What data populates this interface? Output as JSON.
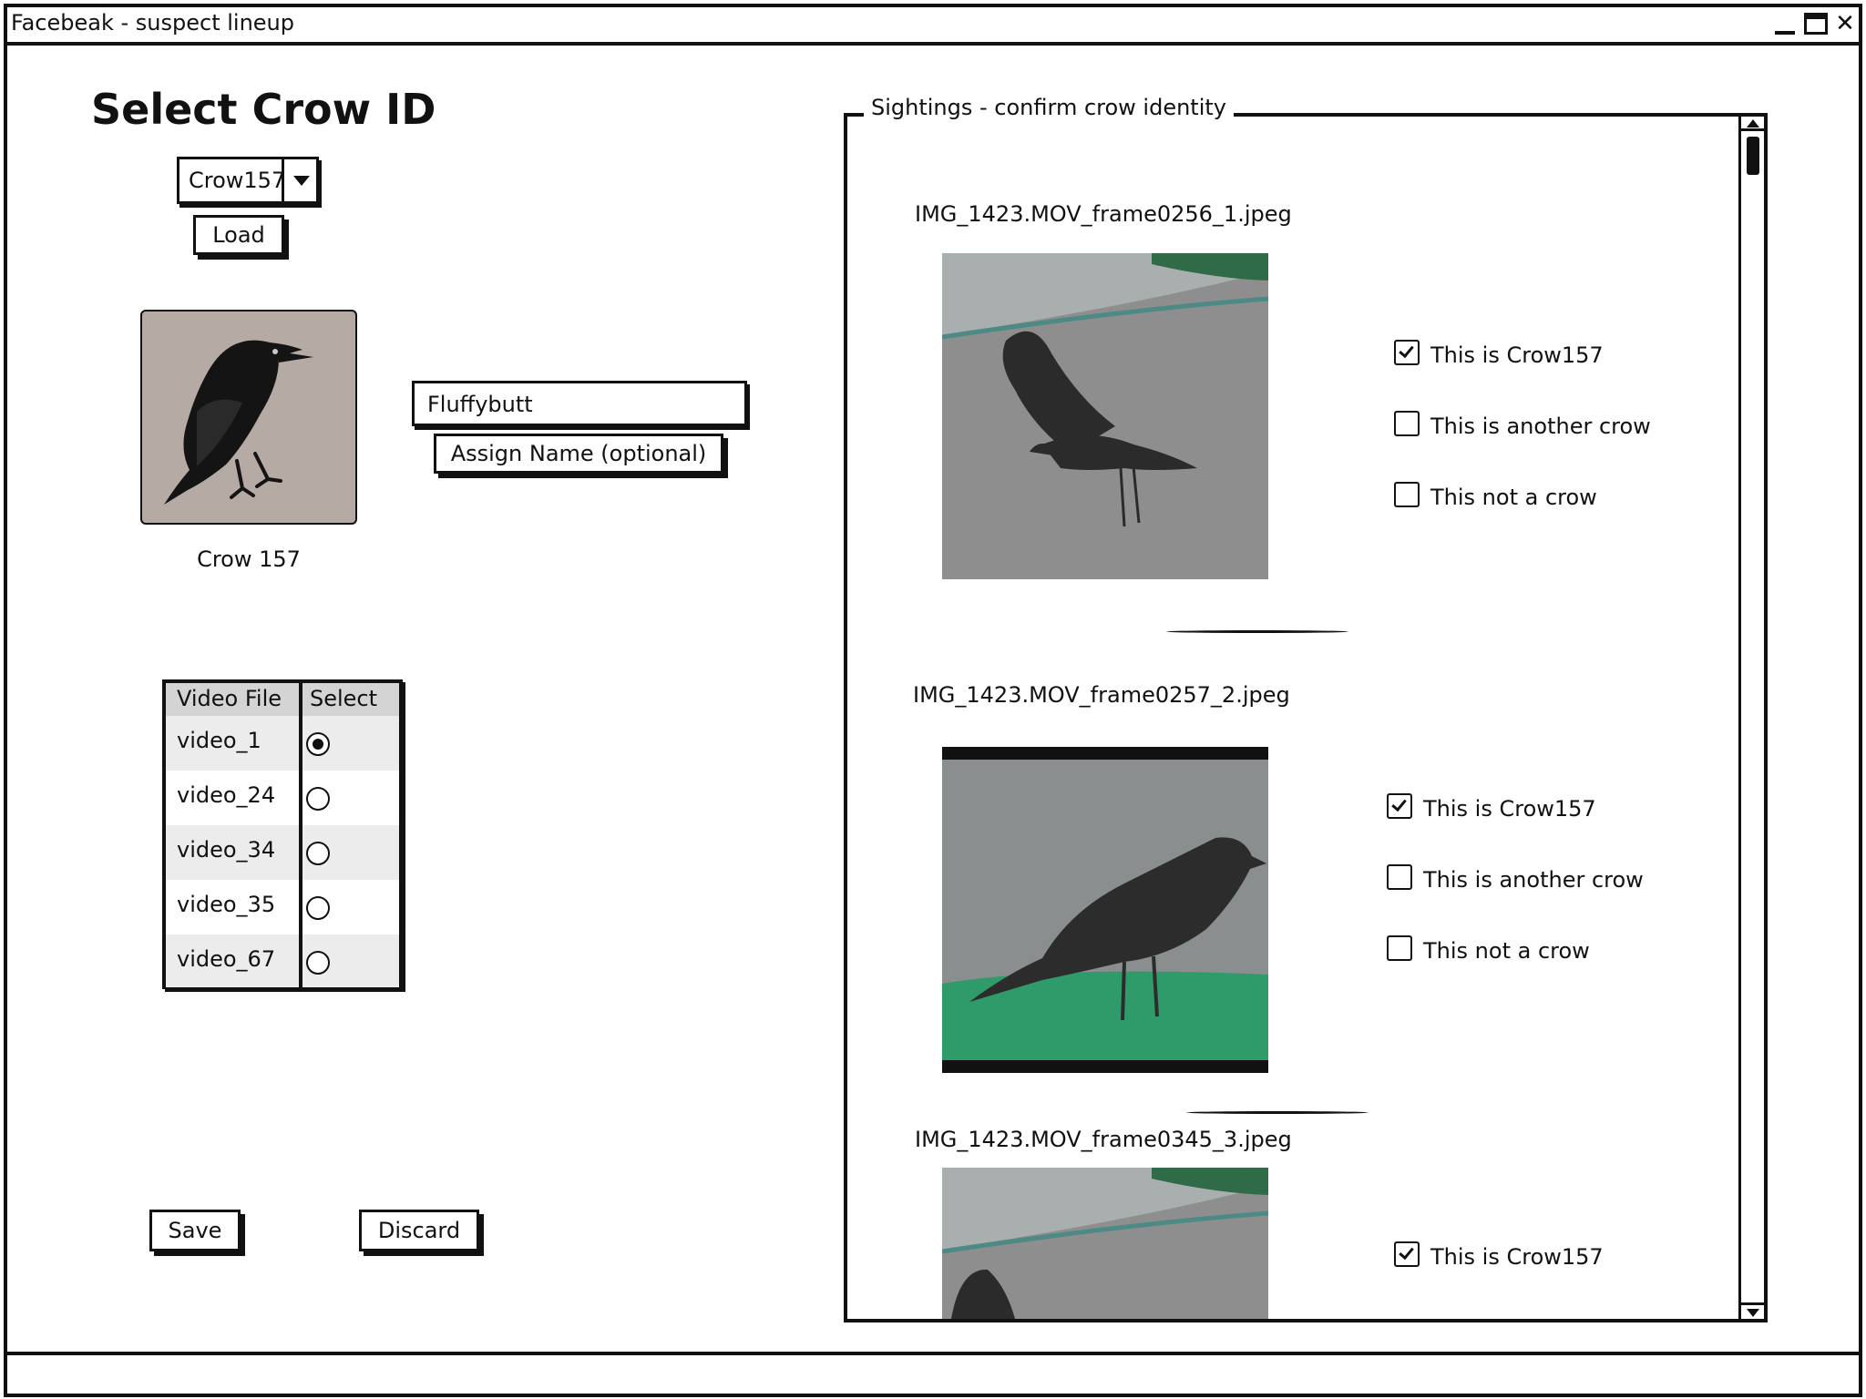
{
  "window": {
    "title": "Facebeak - suspect lineup",
    "controls": [
      "minimize-icon",
      "maximize-icon",
      "close-icon"
    ]
  },
  "left_panel": {
    "title": "Select Crow ID",
    "crow_select": {
      "value": "Crow157",
      "icon": "chevron-down-icon"
    },
    "load_label": "Load",
    "portrait_caption": "Crow 157",
    "name_input": {
      "value": "Fluffybutt"
    },
    "assign_label": "Assign Name (optional)"
  },
  "video_table": {
    "headers": [
      "Video File",
      "Select"
    ],
    "rows": [
      {
        "file": "video_1",
        "selected": true
      },
      {
        "file": "video_24",
        "selected": false
      },
      {
        "file": "video_34",
        "selected": false
      },
      {
        "file": "video_35",
        "selected": false
      },
      {
        "file": "video_67",
        "selected": false
      }
    ]
  },
  "actions": {
    "save_label": "Save",
    "discard_label": "Discard"
  },
  "sightings": {
    "legend": "Sightings - confirm crow identity",
    "items": [
      {
        "filename": "IMG_1423.MOV_frame0256_1.jpeg",
        "options": [
          {
            "label": "This is Crow157",
            "checked": true
          },
          {
            "label": "This is another crow",
            "checked": false
          },
          {
            "label": "This not a crow",
            "checked": false
          }
        ]
      },
      {
        "filename": "IMG_1423.MOV_frame0257_2.jpeg",
        "options": [
          {
            "label": "This is Crow157",
            "checked": true
          },
          {
            "label": "This is another crow",
            "checked": false
          },
          {
            "label": "This not a crow",
            "checked": false
          }
        ]
      },
      {
        "filename": "IMG_1423.MOV_frame0345_3.jpeg",
        "options": [
          {
            "label": "This is Crow157",
            "checked": true
          }
        ]
      }
    ]
  },
  "colors": {
    "ink": "#111111",
    "portrait_bg": "#b5aaa4",
    "table_header": "#d4d4d4",
    "row_shade": "#ececec",
    "grass": "#2f9a6a"
  }
}
